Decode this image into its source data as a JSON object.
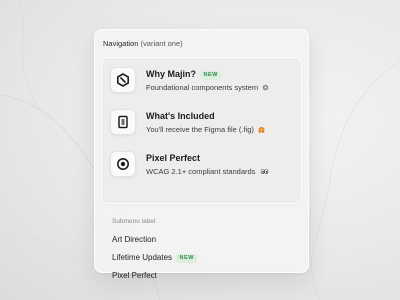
{
  "panel": {
    "title": "Navigation",
    "variant": "(variant one)"
  },
  "items": [
    {
      "title": "Why Majin?",
      "badge": "NEW",
      "subtitle": "Foundational components system",
      "icon": "hexagon-slash-icon",
      "trailing_icon": "gear-emoji-icon"
    },
    {
      "title": "What's Included",
      "subtitle": "You'll receive the Figma file (.fig)",
      "icon": "document-list-icon",
      "trailing_icon": "gift-emoji-icon"
    },
    {
      "title": "Pixel Perfect",
      "subtitle": "WCAG 2.1+ compliant standards",
      "icon": "target-icon",
      "trailing_icon": "eyes-emoji-icon"
    }
  ],
  "submenu": {
    "label": "Submenu label",
    "items": [
      {
        "label": "Art Direction"
      },
      {
        "label": "Lifetime Updates",
        "badge": "NEW"
      },
      {
        "label": "Pixel Perfect"
      }
    ]
  },
  "colors": {
    "badge_text": "#2f8a4a",
    "badge_bg": "#dcefdf",
    "panel_bg": "#f4f4f4",
    "card_bg": "#ececec"
  }
}
